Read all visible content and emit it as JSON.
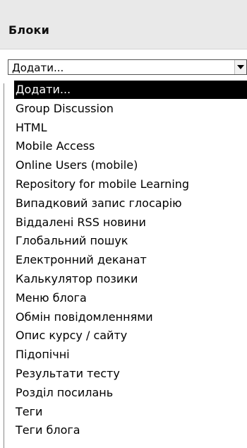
{
  "block": {
    "title": "Блоки"
  },
  "select": {
    "value": "Додати..."
  },
  "options": [
    {
      "label": "Додати...",
      "selected": true
    },
    {
      "label": "Group Discussion"
    },
    {
      "label": "HTML"
    },
    {
      "label": "Mobile Access"
    },
    {
      "label": "Online Users (mobile)"
    },
    {
      "label": "Repository for mobile Learning"
    },
    {
      "label": "Випадковий запис глосарію"
    },
    {
      "label": "Віддалені RSS новини"
    },
    {
      "label": "Глобальний пошук"
    },
    {
      "label": "Електронний деканат"
    },
    {
      "label": "Калькулятор позики"
    },
    {
      "label": "Меню блога"
    },
    {
      "label": "Обмін повідомленнями"
    },
    {
      "label": "Опис курсу / сайту"
    },
    {
      "label": "Підопічні"
    },
    {
      "label": "Результати тесту"
    },
    {
      "label": "Розділ посилань"
    },
    {
      "label": "Теги"
    },
    {
      "label": "Теги блога"
    }
  ],
  "icons": {
    "dropdown_arrow": "chevron-down-icon"
  }
}
